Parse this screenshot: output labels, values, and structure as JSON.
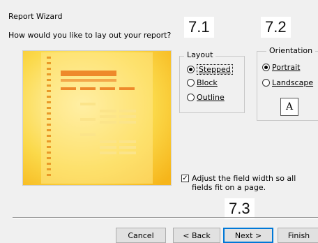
{
  "window": {
    "title": "Report Wizard"
  },
  "prompt": "How would you like to lay out your report?",
  "callouts": [
    "7.1",
    "7.2",
    "7.3"
  ],
  "layout": {
    "label": "Layout",
    "options": [
      {
        "label": "Stepped",
        "selected": true
      },
      {
        "label": "Block",
        "selected": false
      },
      {
        "label": "Outline",
        "selected": false
      }
    ]
  },
  "orientation": {
    "label": "Orientation",
    "options": [
      {
        "label": "Portrait",
        "selected": true
      },
      {
        "label": "Landscape",
        "selected": false
      }
    ],
    "icon_letter": "A"
  },
  "adjust_width": {
    "label": "Adjust the field width so all fields fit on a page.",
    "checked": true
  },
  "buttons": {
    "cancel": "Cancel",
    "back": "< Back",
    "next": "Next >",
    "finish": "Finish"
  },
  "colors": {
    "accent": "#0078d7",
    "preview_yellow": "#f9c623",
    "preview_orange": "#ee8a2b"
  }
}
